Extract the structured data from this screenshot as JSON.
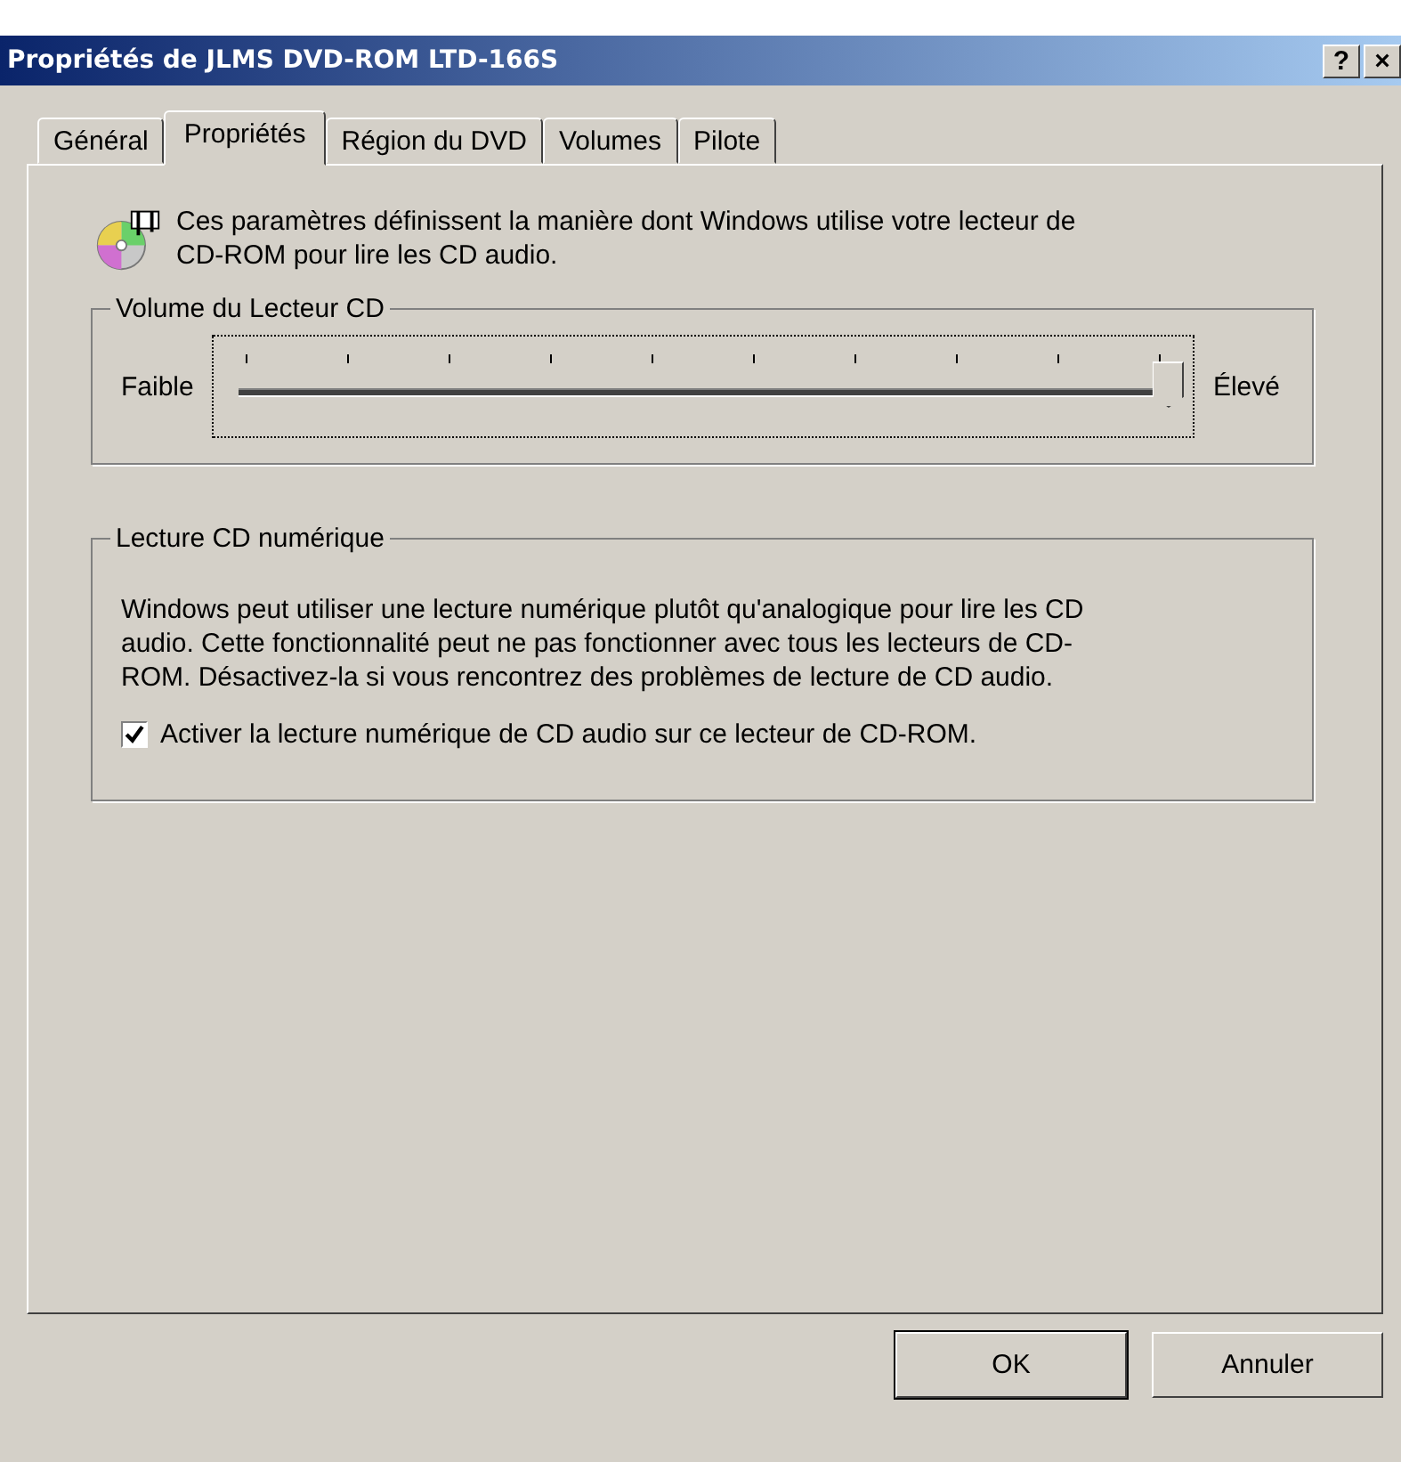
{
  "window": {
    "title": "Propriétés de JLMS DVD-ROM LTD-166S",
    "help_button": "?",
    "close_button": "×"
  },
  "tabs": [
    {
      "label": "Général",
      "selected": false
    },
    {
      "label": "Propriétés",
      "selected": true
    },
    {
      "label": "Région du DVD",
      "selected": false
    },
    {
      "label": "Volumes",
      "selected": false
    },
    {
      "label": "Pilote",
      "selected": false
    }
  ],
  "intro": "Ces paramètres définissent la manière dont Windows utilise votre lecteur de CD-ROM pour lire les CD audio.",
  "volume_group": {
    "title": "Volume du Lecteur CD",
    "min_label": "Faible",
    "max_label": "Élevé",
    "level": 1
  },
  "digital_group": {
    "title": "Lecture CD numérique",
    "description": "Windows peut utiliser une lecture numérique plutôt qu'analogique pour lire les CD audio. Cette fonctionnalité peut ne pas fonctionner avec tous les lecteurs de CD-ROM. Désactivez-la si vous rencontrez des problèmes de lecture de CD audio.",
    "checkbox": {
      "label": "Activer la lecture numérique de CD audio sur ce lecteur de CD-ROM.",
      "checked": true
    }
  },
  "buttons": [
    {
      "label": "OK",
      "default": true
    },
    {
      "label": "Annuler",
      "default": false
    }
  ]
}
